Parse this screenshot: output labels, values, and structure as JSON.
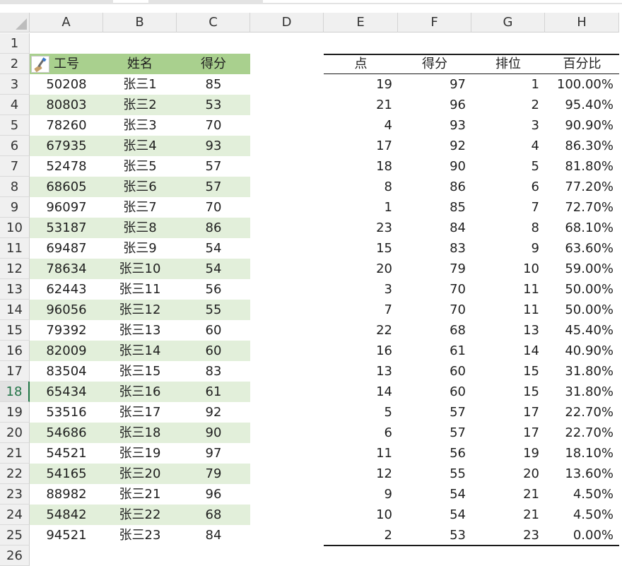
{
  "columns": [
    "A",
    "B",
    "C",
    "D",
    "E",
    "F",
    "G",
    "H"
  ],
  "rows": [
    "1",
    "2",
    "3",
    "4",
    "5",
    "6",
    "7",
    "8",
    "9",
    "10",
    "11",
    "12",
    "13",
    "14",
    "15",
    "16",
    "17",
    "18",
    "19",
    "20",
    "21",
    "22",
    "23",
    "24",
    "25",
    "26"
  ],
  "active_row": "18",
  "left_table": {
    "headers": [
      "工号",
      "姓名",
      "得分"
    ],
    "rows": [
      [
        "50208",
        "张三1",
        "85"
      ],
      [
        "80803",
        "张三2",
        "53"
      ],
      [
        "78260",
        "张三3",
        "70"
      ],
      [
        "67935",
        "张三4",
        "93"
      ],
      [
        "52478",
        "张三5",
        "57"
      ],
      [
        "68605",
        "张三6",
        "57"
      ],
      [
        "96097",
        "张三7",
        "70"
      ],
      [
        "53187",
        "张三8",
        "86"
      ],
      [
        "69487",
        "张三9",
        "54"
      ],
      [
        "78634",
        "张三10",
        "54"
      ],
      [
        "62443",
        "张三11",
        "56"
      ],
      [
        "96056",
        "张三12",
        "55"
      ],
      [
        "79392",
        "张三13",
        "60"
      ],
      [
        "82009",
        "张三14",
        "60"
      ],
      [
        "83504",
        "张三15",
        "83"
      ],
      [
        "65434",
        "张三16",
        "61"
      ],
      [
        "53516",
        "张三17",
        "92"
      ],
      [
        "54686",
        "张三18",
        "90"
      ],
      [
        "54521",
        "张三19",
        "97"
      ],
      [
        "54165",
        "张三20",
        "79"
      ],
      [
        "88982",
        "张三21",
        "96"
      ],
      [
        "54842",
        "张三22",
        "68"
      ],
      [
        "94521",
        "张三23",
        "84"
      ]
    ]
  },
  "right_table": {
    "headers": [
      "点",
      "得分",
      "排位",
      "百分比"
    ],
    "rows": [
      [
        "19",
        "97",
        "1",
        "100.00%"
      ],
      [
        "21",
        "96",
        "2",
        "95.40%"
      ],
      [
        "4",
        "93",
        "3",
        "90.90%"
      ],
      [
        "17",
        "92",
        "4",
        "86.30%"
      ],
      [
        "18",
        "90",
        "5",
        "81.80%"
      ],
      [
        "8",
        "86",
        "6",
        "77.20%"
      ],
      [
        "1",
        "85",
        "7",
        "72.70%"
      ],
      [
        "23",
        "84",
        "8",
        "68.10%"
      ],
      [
        "15",
        "83",
        "9",
        "63.60%"
      ],
      [
        "20",
        "79",
        "10",
        "59.00%"
      ],
      [
        "3",
        "70",
        "11",
        "50.00%"
      ],
      [
        "7",
        "70",
        "11",
        "50.00%"
      ],
      [
        "22",
        "68",
        "13",
        "45.40%"
      ],
      [
        "16",
        "61",
        "14",
        "40.90%"
      ],
      [
        "13",
        "60",
        "15",
        "31.80%"
      ],
      [
        "14",
        "60",
        "15",
        "31.80%"
      ],
      [
        "5",
        "57",
        "17",
        "22.70%"
      ],
      [
        "6",
        "57",
        "17",
        "22.70%"
      ],
      [
        "11",
        "56",
        "19",
        "18.10%"
      ],
      [
        "12",
        "55",
        "20",
        "13.60%"
      ],
      [
        "9",
        "54",
        "21",
        "4.50%"
      ],
      [
        "10",
        "54",
        "21",
        "4.50%"
      ],
      [
        "2",
        "53",
        "23",
        "0.00%"
      ]
    ]
  },
  "icons": {
    "format_painter": "paintbrush-icon"
  },
  "colors": {
    "header_band": "#a9d08e",
    "stripe": "#e2efda",
    "active_row_header": "#217346"
  }
}
